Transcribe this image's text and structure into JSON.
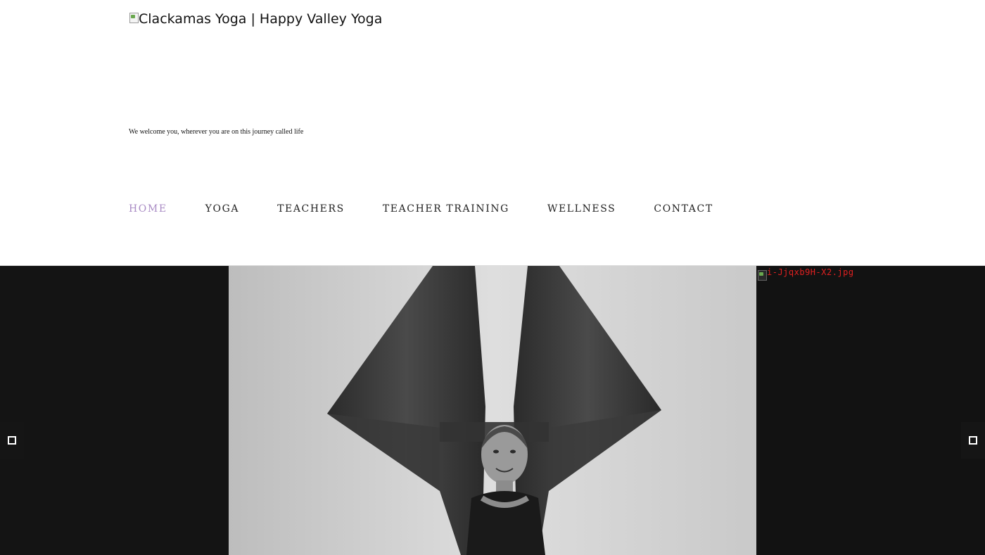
{
  "header": {
    "logo_alt": "Clackamas Yoga | Happy Valley Yoga",
    "tagline": "We welcome you, wherever you are on this journey called life"
  },
  "nav": {
    "items": [
      {
        "label": "HOME",
        "active": true
      },
      {
        "label": "YOGA"
      },
      {
        "label": "TEACHERS"
      },
      {
        "label": "TEACHER TRAINING"
      },
      {
        "label": "WELLNESS"
      },
      {
        "label": "CONTACT"
      }
    ]
  },
  "hero": {
    "next_slide_alt": "i-Jjqxb9H-X2.jpg",
    "prev_icon": "square-icon",
    "next_icon": "square-icon"
  },
  "colors": {
    "active_nav": "#a98bc4",
    "nav_text": "#222222",
    "hero_bg": "#141414",
    "broken_alt_text": "#e02020"
  }
}
